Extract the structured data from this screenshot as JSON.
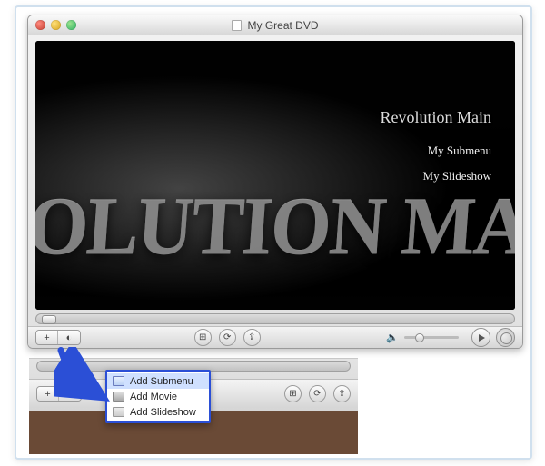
{
  "window": {
    "title": "My Great DVD"
  },
  "preview": {
    "bg_text": "/OLUTION MA",
    "menu_title": "Revolution Main",
    "items": [
      "My Submenu",
      "My Slideshow"
    ]
  },
  "toolbar": {
    "add_glyph": "+",
    "info_glyph": "◐",
    "share_glyph": "⇪",
    "loop_glyph": "⟳",
    "map_glyph": "⊞",
    "speaker_glyph": "🔈"
  },
  "popup": {
    "items": [
      "Add Submenu",
      "Add Movie",
      "Add Slideshow"
    ]
  }
}
